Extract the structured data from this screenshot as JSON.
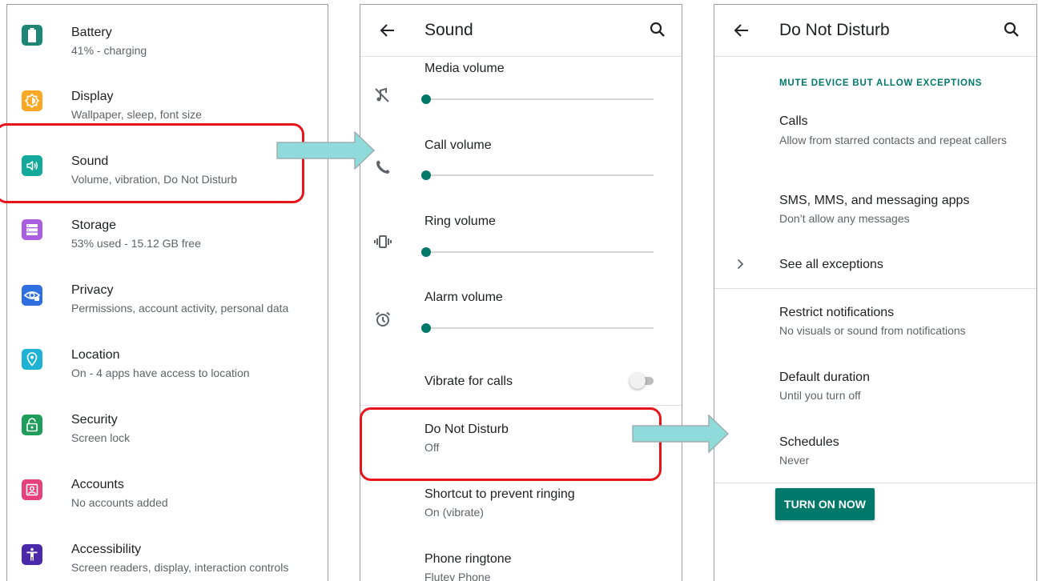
{
  "settings_list": {
    "items": [
      {
        "title": "Battery",
        "subtitle": "41% - charging",
        "icon": "battery-icon",
        "color": "#1e8676"
      },
      {
        "title": "Display",
        "subtitle": "Wallpaper, sleep, font size",
        "icon": "brightness-icon",
        "color": "#f9a825"
      },
      {
        "title": "Sound",
        "subtitle": "Volume, vibration, Do Not Disturb",
        "icon": "volume-icon",
        "color": "#12a89a"
      },
      {
        "title": "Storage",
        "subtitle": "53% used - 15.12 GB free",
        "icon": "storage-icon",
        "color": "#a85ee0"
      },
      {
        "title": "Privacy",
        "subtitle": "Permissions, account activity, personal data",
        "icon": "privacy-eye-icon",
        "color": "#2f6fe0"
      },
      {
        "title": "Location",
        "subtitle": "On - 4 apps have access to location",
        "icon": "location-pin-icon",
        "color": "#1eb3d4"
      },
      {
        "title": "Security",
        "subtitle": "Screen lock",
        "icon": "lock-icon",
        "color": "#1e9e5a"
      },
      {
        "title": "Accounts",
        "subtitle": "No accounts added",
        "icon": "account-box-icon",
        "color": "#e5417a"
      },
      {
        "title": "Accessibility",
        "subtitle": "Screen readers, display, interaction controls",
        "icon": "accessibility-icon",
        "color": "#4a2aa8"
      }
    ]
  },
  "sound_screen": {
    "title": "Sound",
    "back_icon": "arrow-back-icon",
    "search_icon": "search-icon",
    "volumes": [
      {
        "label": "Media volume",
        "icon": "media-off-icon",
        "level": 0
      },
      {
        "label": "Call volume",
        "icon": "phone-icon",
        "level": 0
      },
      {
        "label": "Ring volume",
        "icon": "vibrate-icon",
        "level": 0
      },
      {
        "label": "Alarm volume",
        "icon": "alarm-icon",
        "level": 0
      }
    ],
    "vibrate_for_calls": {
      "label": "Vibrate for calls",
      "enabled": false
    },
    "do_not_disturb": {
      "title": "Do Not Disturb",
      "status": "Off"
    },
    "shortcut": {
      "title": "Shortcut to prevent ringing",
      "status": "On (vibrate)"
    },
    "ringtone": {
      "title": "Phone ringtone",
      "value": "Flutey Phone"
    }
  },
  "dnd_screen": {
    "title": "Do Not Disturb",
    "section_label": "MUTE DEVICE BUT ALLOW EXCEPTIONS",
    "calls": {
      "title": "Calls",
      "subtitle": "Allow from starred contacts and repeat callers"
    },
    "messages": {
      "title": "SMS, MMS, and messaging apps",
      "subtitle": "Don’t allow any messages"
    },
    "see_all": {
      "title": "See all exceptions"
    },
    "restrict": {
      "title": "Restrict notifications",
      "subtitle": "No visuals or sound from notifications"
    },
    "duration": {
      "title": "Default duration",
      "subtitle": "Until you turn off"
    },
    "schedules": {
      "title": "Schedules",
      "subtitle": "Never"
    },
    "turn_on_button": "TURN ON NOW"
  },
  "colors": {
    "accent": "#00796b",
    "highlight": "#e8141b",
    "arrow": "#8fdada"
  }
}
